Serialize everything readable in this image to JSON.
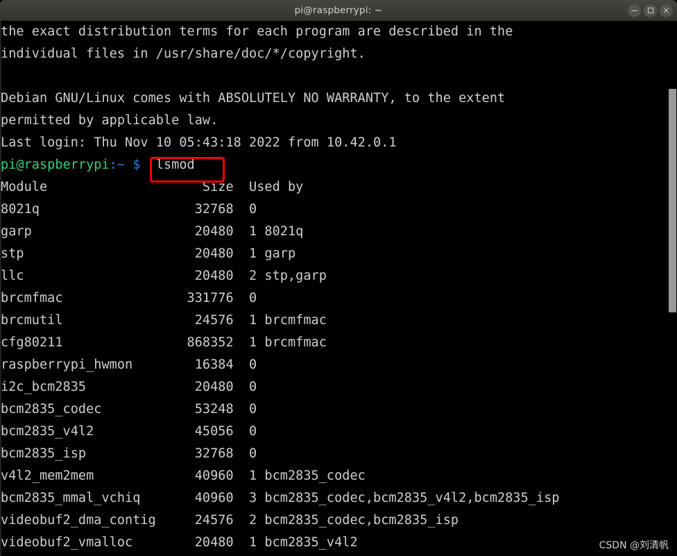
{
  "window": {
    "title": "pi@raspberrypi: ~",
    "controls": {
      "minimize_label": "",
      "maximize_label": "",
      "close_label": "×"
    }
  },
  "terminal": {
    "preamble": [
      "the exact distribution terms for each program are described in the",
      "individual files in /usr/share/doc/*/copyright.",
      "",
      "Debian GNU/Linux comes with ABSOLUTELY NO WARRANTY, to the extent",
      "permitted by applicable law.",
      "Last login: Thu Nov 10 05:43:18 2022 from 10.42.0.1"
    ],
    "prompt": {
      "user_host": "pi@raspberrypi",
      "path": ":~",
      "symbol": "$",
      "command": "lsmod"
    },
    "table": {
      "headers": [
        "Module",
        "Size",
        "Used by"
      ],
      "rows": [
        {
          "module": "8021q",
          "size": "32768",
          "used": "0",
          "by": ""
        },
        {
          "module": "garp",
          "size": "20480",
          "used": "1",
          "by": "8021q"
        },
        {
          "module": "stp",
          "size": "20480",
          "used": "1",
          "by": "garp"
        },
        {
          "module": "llc",
          "size": "20480",
          "used": "2",
          "by": "stp,garp"
        },
        {
          "module": "brcmfmac",
          "size": "331776",
          "used": "0",
          "by": ""
        },
        {
          "module": "brcmutil",
          "size": "24576",
          "used": "1",
          "by": "brcmfmac"
        },
        {
          "module": "cfg80211",
          "size": "868352",
          "used": "1",
          "by": "brcmfmac"
        },
        {
          "module": "raspberrypi_hwmon",
          "size": "16384",
          "used": "0",
          "by": ""
        },
        {
          "module": "i2c_bcm2835",
          "size": "20480",
          "used": "0",
          "by": ""
        },
        {
          "module": "bcm2835_codec",
          "size": "53248",
          "used": "0",
          "by": ""
        },
        {
          "module": "bcm2835_v4l2",
          "size": "45056",
          "used": "0",
          "by": ""
        },
        {
          "module": "bcm2835_isp",
          "size": "32768",
          "used": "0",
          "by": ""
        },
        {
          "module": "v4l2_mem2mem",
          "size": "40960",
          "used": "1",
          "by": "bcm2835_codec"
        },
        {
          "module": "bcm2835_mmal_vchiq",
          "size": "40960",
          "used": "3",
          "by": "bcm2835_codec,bcm2835_v4l2,bcm2835_isp"
        },
        {
          "module": "videobuf2_dma_contig",
          "size": "24576",
          "used": "2",
          "by": "bcm2835_codec,bcm2835_isp"
        },
        {
          "module": "videobuf2_vmalloc",
          "size": "20480",
          "used": "1",
          "by": "bcm2835_v4l2"
        }
      ]
    }
  },
  "annotation": {
    "highlight_color": "#fe0000",
    "highlight_target": "lsmod"
  },
  "watermark": {
    "text": "CSDN @刘清帆"
  },
  "colors": {
    "background": "#000000",
    "foreground": "#d0cfcc",
    "prompt_green": "#33d17a",
    "prompt_blue": "#2a7bde",
    "titlebar": "#3c3b36"
  }
}
